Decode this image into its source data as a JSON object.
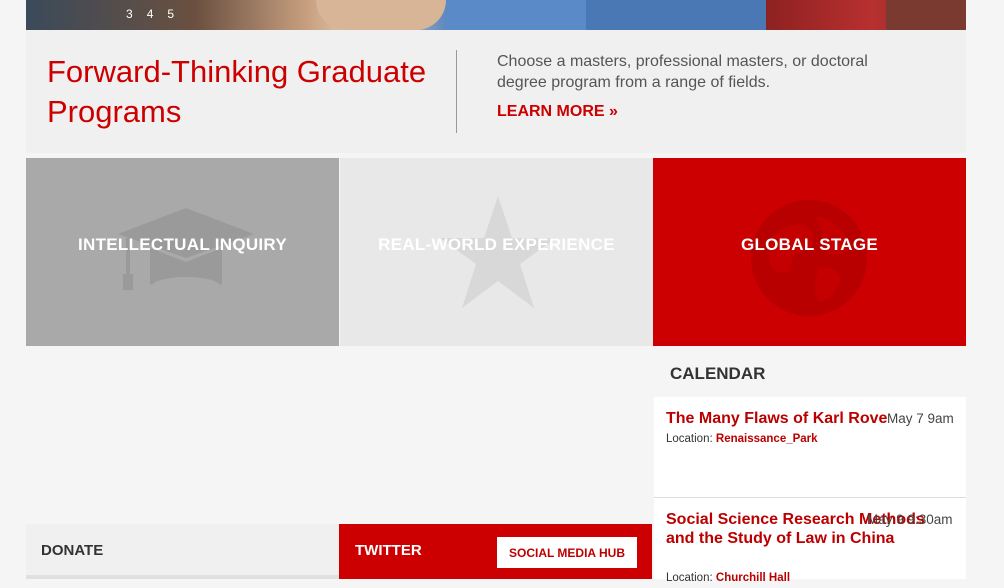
{
  "slider": {
    "dots": [
      "3",
      "4",
      "5"
    ]
  },
  "banner": {
    "title": "Forward-Thinking Graduate Programs",
    "description": "Choose a masters, professional masters, or doctoral degree program from a range of fields.",
    "link": "LEARN MORE »"
  },
  "tiles": [
    {
      "label": "INTELLECTUAL INQUIRY",
      "icon": "graduation-cap-icon",
      "color": "#a9a9a9"
    },
    {
      "label": "REAL-WORLD EXPERIENCE",
      "icon": "star-icon",
      "color": "#e8e8e8"
    },
    {
      "label": "GLOBAL STAGE",
      "icon": "globe-icon",
      "color": "#cc0000"
    }
  ],
  "calendar": {
    "heading": "CALENDAR",
    "events": [
      {
        "title": "The Many Flaws of Karl Rove",
        "date": "May 7 9am",
        "location_label": "Location:",
        "location": "Renaissance_Park"
      },
      {
        "title": "Social Science Research Methods and the Study of Law in China",
        "date": "May 9 9:30am",
        "location_label": "Location:",
        "location": "Churchill Hall"
      }
    ]
  },
  "donate": {
    "heading": "DONATE"
  },
  "twitter": {
    "heading": "TWITTER",
    "button": "SOCIAL MEDIA HUB"
  },
  "colors": {
    "accent": "#cc0000",
    "tile_gray": "#a9a9a9",
    "tile_light": "#e8e8e8"
  }
}
